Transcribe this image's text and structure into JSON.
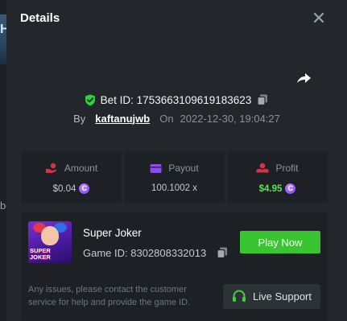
{
  "background": {
    "thumb_text": "H",
    "side_text_1": "bo",
    "side_text_2": "C"
  },
  "modal": {
    "title": "Details"
  },
  "bet": {
    "id_label": "Bet ID: 1753663109619183623",
    "by_label": "By",
    "username": "kaftanujwb",
    "on_label": "On",
    "datetime": "2022-12-30, 19:04:27"
  },
  "stats": {
    "amount": {
      "label": "Amount",
      "value": "$0.04"
    },
    "payout": {
      "label": "Payout",
      "value": "100.1002 x"
    },
    "profit": {
      "label": "Profit",
      "value": "$4.95"
    }
  },
  "game": {
    "thumb_label": "SUPER JOKER",
    "name": "Super Joker",
    "id_label": "Game ID: 8302808332013",
    "play_label": "Play Now"
  },
  "support": {
    "text": "Any issues, please contact the customer service for help and provide the game ID.",
    "button_label": "Live Support"
  },
  "colors": {
    "modal_bg": "#23272b",
    "card_bg": "#1d2024",
    "accent_green": "#39c52f",
    "profit_green": "#5ce05c",
    "shield_green": "#2fd13a",
    "amount_red": "#d4334b",
    "payout_purple": "#8e4dea",
    "coin_purple": "#7a3fe0"
  },
  "icons": {
    "close": "close-icon",
    "share": "share-icon",
    "shield": "shield-check-icon",
    "copy": "copy-icon",
    "amount": "hand-coin-icon",
    "payout": "wallet-icon",
    "profit": "hand-money-icon",
    "coin": "coin-icon",
    "headset": "headset-icon"
  }
}
